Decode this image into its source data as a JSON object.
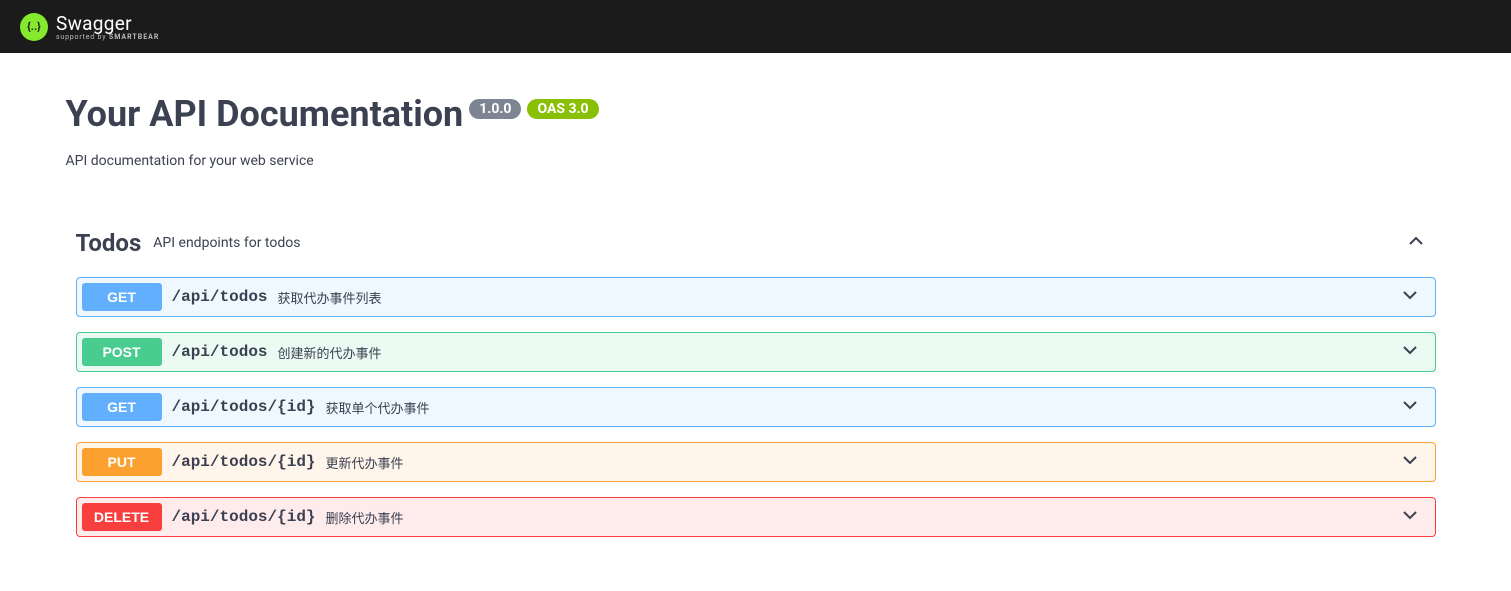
{
  "header": {
    "logo_text": "Swagger",
    "logo_sub_prefix": "supported by ",
    "logo_sub_bold": "SMARTBEAR"
  },
  "info": {
    "title": "Your API Documentation",
    "version": "1.0.0",
    "oas": "OAS 3.0",
    "description": "API documentation for your web service"
  },
  "tag": {
    "name": "Todos",
    "description": "API endpoints for todos"
  },
  "operations": [
    {
      "method": "GET",
      "path": "/api/todos",
      "summary": "获取代办事件列表"
    },
    {
      "method": "POST",
      "path": "/api/todos",
      "summary": "创建新的代办事件"
    },
    {
      "method": "GET",
      "path": "/api/todos/{id}",
      "summary": "获取单个代办事件"
    },
    {
      "method": "PUT",
      "path": "/api/todos/{id}",
      "summary": "更新代办事件"
    },
    {
      "method": "DELETE",
      "path": "/api/todos/{id}",
      "summary": "删除代办事件"
    }
  ]
}
